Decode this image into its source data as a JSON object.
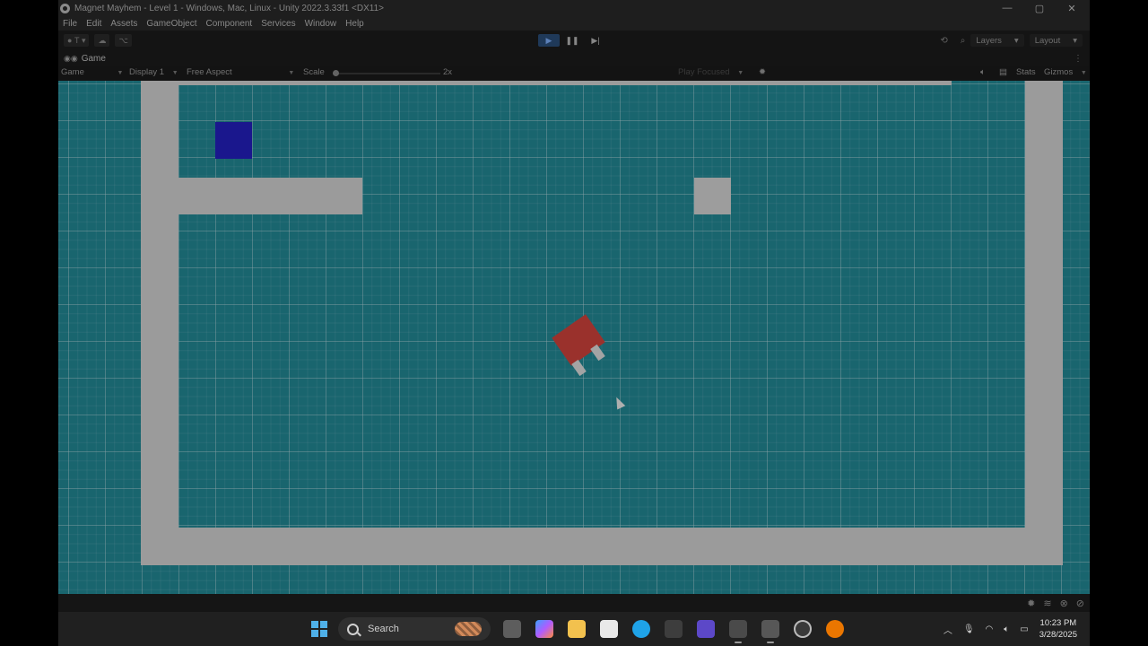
{
  "window": {
    "title": "Magnet Mayhem - Level 1 - Windows, Mac, Linux - Unity 2022.3.33f1 <DX11>",
    "minimize": "—",
    "maximize": "▢",
    "close": "✕"
  },
  "menu": [
    "File",
    "Edit",
    "Assets",
    "GameObject",
    "Component",
    "Services",
    "Window",
    "Help"
  ],
  "toolbar": {
    "account": "T",
    "play_icon": "play-icon",
    "pause_icon": "pause-icon",
    "step_icon": "step-icon",
    "layers": "Layers",
    "layout": "Layout"
  },
  "tab": {
    "label": "Game",
    "icon": "gamepad-icon"
  },
  "gamebar": {
    "mode": "Game",
    "display": "Display 1",
    "aspect": "Free Aspect",
    "scale_label": "Scale",
    "scale_value": "2x",
    "play_focused": "Play Focused",
    "stats": "Stats",
    "gizmos": "Gizmos"
  },
  "scene": {
    "background_color": "#238c99",
    "wall_color": "#d7d7d7",
    "player_color": "#2420c4",
    "magnet_color": "#d6453e"
  },
  "taskbar": {
    "search_placeholder": "Search",
    "time": "10:23 PM",
    "date": "3/28/2025",
    "apps": [
      "task-view-icon",
      "copilot-icon",
      "file-explorer-icon",
      "store-icon",
      "browser-icon",
      "unity-hub-icon",
      "visual-studio-icon",
      "unity-icon",
      "unity-editor-icon",
      "chrome-icon",
      "blender-icon"
    ]
  }
}
